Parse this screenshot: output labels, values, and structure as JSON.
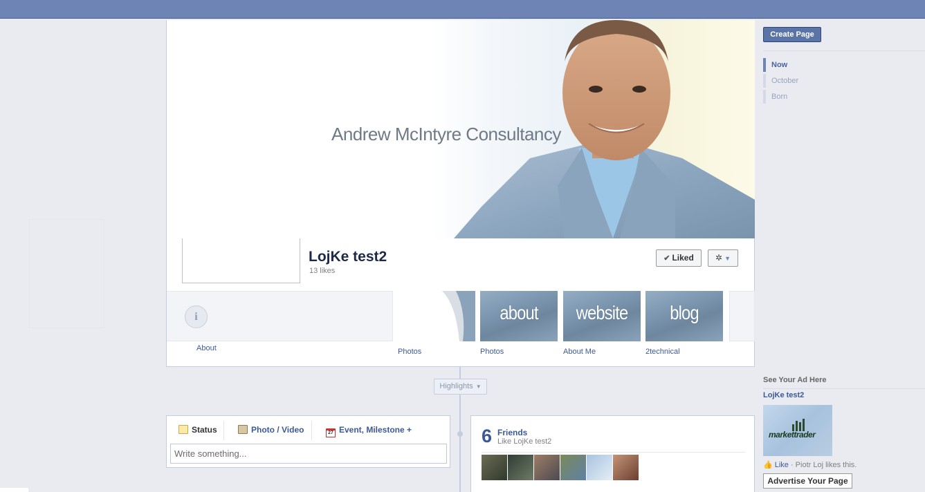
{
  "window": {
    "background": "#e9ebf1",
    "topbar_color": "#6d84b4",
    "link_color": "#3b5998"
  },
  "cover": {
    "title": "Andrew McIntyre Consultancy"
  },
  "page": {
    "name": "LojKe test2",
    "likes": "13 likes",
    "liked_button": "Liked",
    "settings_icon": "gear-icon"
  },
  "apps": {
    "about_label": "About",
    "items": [
      {
        "label": "Photos",
        "thumb_text": ""
      },
      {
        "label": "Photos",
        "thumb_text": "about"
      },
      {
        "label": "About Me",
        "thumb_text": "website"
      },
      {
        "label": "2technical",
        "thumb_text": "blog"
      }
    ]
  },
  "highlights": {
    "label": "Highlights"
  },
  "composer": {
    "tabs": [
      "Status",
      "Photo / Video",
      "Event, Milestone +"
    ],
    "event_icon_day": "27",
    "placeholder": "Write something..."
  },
  "friends": {
    "count": "6",
    "title": "Friends",
    "subtitle": "Like LojKe test2"
  },
  "sidebar": {
    "create_page": "Create Page",
    "timeline_nav": [
      "Now",
      "October",
      "Born"
    ],
    "ad": {
      "section_title": "See Your Ad Here",
      "page_name": "LojKe test2",
      "logo_text": "markettrader",
      "like_link": "Like",
      "like_text": "· Piotr Loj likes this.",
      "advertise_button": "Advertise Your Page"
    }
  }
}
